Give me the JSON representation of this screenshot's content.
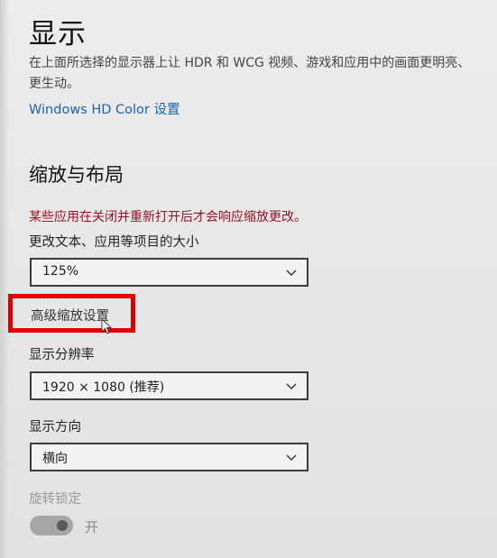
{
  "display": {
    "title": "显示",
    "description": "在上面所选择的显示器上让 HDR 和 WCG 视频、游戏和应用中的画面更明亮、更生动。",
    "hd_color_link": "Windows HD Color 设置"
  },
  "scale_layout": {
    "section_title": "缩放与布局",
    "warning": "某些应用在关闭并重新打开后才会响应缩放更改。",
    "size_label": "更改文本、应用等项目的大小",
    "size_value": "125%",
    "advanced_link": "高级缩放设置",
    "resolution_label": "显示分辨率",
    "resolution_value": "1920 × 1080 (推荐)",
    "orientation_label": "显示方向",
    "orientation_value": "横向",
    "rotation_lock_label": "旋转锁定",
    "rotation_lock_state": "开"
  },
  "icons": {
    "chevron": "chevron-down-icon",
    "cursor": "mouse-pointer-icon"
  },
  "colors": {
    "link": "#1b62b3",
    "warning": "#9c1025",
    "highlight": "#e10000"
  }
}
